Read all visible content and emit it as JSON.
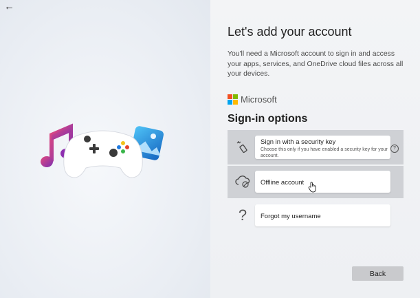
{
  "nav": {
    "back_arrow": "←"
  },
  "header": {
    "title": "Let's add your account",
    "description": "You'll need a Microsoft account to sign in and access your apps, services, and OneDrive cloud files across all your devices."
  },
  "brand": {
    "name": "Microsoft",
    "colors": [
      "#f25022",
      "#7fba00",
      "#00a4ef",
      "#ffb900"
    ]
  },
  "signin": {
    "heading": "Sign-in options",
    "options": [
      {
        "icon": "security-key-icon",
        "label": "Sign in with a security key",
        "sublabel": "Choose this only if you have enabled a security key for your account.",
        "help": "?"
      },
      {
        "icon": "cloud-offline-icon",
        "label": "Offline account"
      },
      {
        "icon": "question-mark-icon",
        "glyph": "?",
        "label": "Forgot my username"
      }
    ]
  },
  "footer": {
    "back_label": "Back"
  }
}
